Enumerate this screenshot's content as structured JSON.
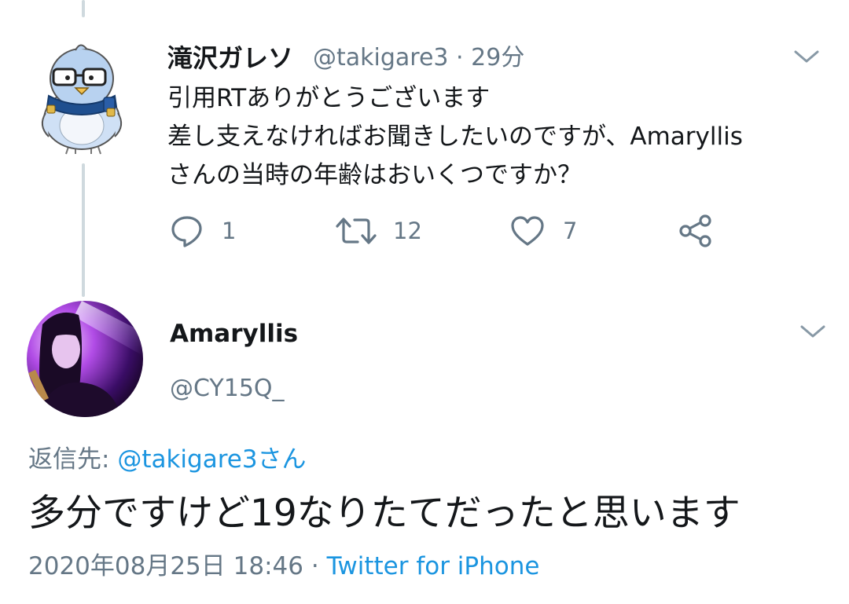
{
  "thread": {
    "tweet": {
      "display_name": "滝沢ガレソ",
      "handle": "@takigare3",
      "separator": "·",
      "time": "29分",
      "lines": [
        "引用RTありがとうございます",
        "差し支えなければお聞きしたいのですが、Amaryllis",
        "さんの当時の年齢はおいくつですか？"
      ],
      "actions": {
        "reply_count": "1",
        "retweet_count": "12",
        "like_count": "7"
      }
    },
    "focused": {
      "display_name": "Amaryllis",
      "handle": "@CY15Q_",
      "reply_to_label": "返信先:",
      "reply_to_mention": "@takigare3さん",
      "text": "多分ですけど19なりたてだったと思います",
      "timestamp": "2020年08月25日 18:46",
      "separator": "·",
      "source": "Twitter for iPhone"
    }
  },
  "icons": {
    "chevron": "chevron-down-icon",
    "reply": "reply-icon",
    "retweet": "retweet-icon",
    "like": "heart-icon",
    "share": "share-icon"
  },
  "colors": {
    "text": "#14171a",
    "secondary": "#657786",
    "link": "#1b95e0",
    "thread_line": "#cfd9de"
  }
}
